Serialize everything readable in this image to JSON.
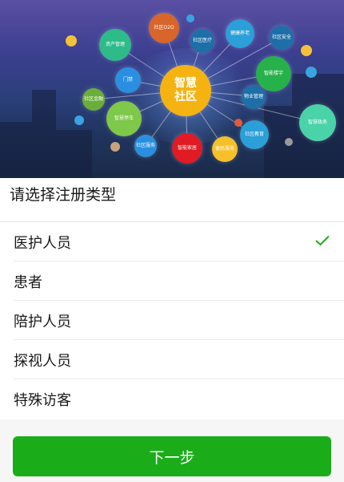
{
  "banner": {
    "center_node": "智慧\n社区",
    "nodes": [
      {
        "id": "o2o",
        "label": "社区O2O"
      },
      {
        "id": "asset",
        "label": "资产管理"
      },
      {
        "id": "hospital",
        "label": "社区医疗"
      },
      {
        "id": "health",
        "label": "健康养老"
      },
      {
        "id": "security",
        "label": "社区安全"
      },
      {
        "id": "door",
        "label": "门禁"
      },
      {
        "id": "smart-building",
        "label": "智能楼宇"
      },
      {
        "id": "finance",
        "label": "社区金融"
      },
      {
        "id": "property",
        "label": "物业管理"
      },
      {
        "id": "parking",
        "label": "智慧停车"
      },
      {
        "id": "gov",
        "label": "智慧政务"
      },
      {
        "id": "service",
        "label": "社区服务"
      },
      {
        "id": "home",
        "label": "智能家居"
      },
      {
        "id": "convenience",
        "label": "便民服务"
      },
      {
        "id": "edu",
        "label": "社区教育"
      }
    ]
  },
  "page": {
    "title": "请选择注册类型"
  },
  "options": [
    {
      "label": "医护人员",
      "selected": true
    },
    {
      "label": "患者",
      "selected": false
    },
    {
      "label": "陪护人员",
      "selected": false
    },
    {
      "label": "探视人员",
      "selected": false
    },
    {
      "label": "特殊访客",
      "selected": false
    }
  ],
  "actions": {
    "next_label": "下一步"
  },
  "colors": {
    "accent": "#1aad19",
    "check": "#1aad19"
  }
}
